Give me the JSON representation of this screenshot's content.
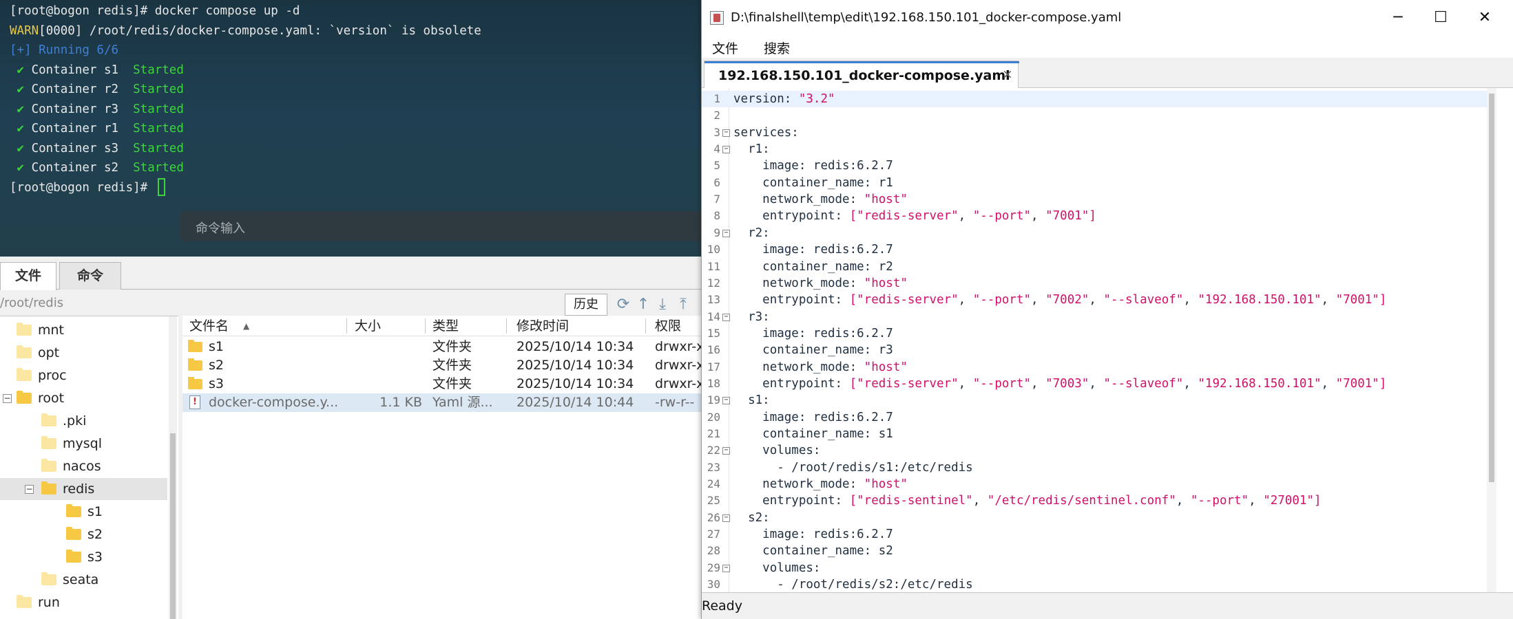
{
  "terminal": {
    "lines": [
      {
        "parts": [
          {
            "t": "[root@bogon redis]# docker compose up -d",
            "c": ""
          }
        ]
      },
      {
        "parts": [
          {
            "t": "WARN",
            "c": "c-warn"
          },
          {
            "t": "[0000] /root/redis/docker-compose.yaml: `version` is obsolete",
            "c": ""
          }
        ]
      },
      {
        "parts": [
          {
            "t": "[+] Running 6/6",
            "c": "c-blue"
          }
        ]
      },
      {
        "parts": [
          {
            "t": " ✔ ",
            "c": "c-check"
          },
          {
            "t": "Container s1  ",
            "c": ""
          },
          {
            "t": "Started",
            "c": "c-green"
          }
        ]
      },
      {
        "parts": [
          {
            "t": " ✔ ",
            "c": "c-check"
          },
          {
            "t": "Container r2  ",
            "c": ""
          },
          {
            "t": "Started",
            "c": "c-green"
          }
        ]
      },
      {
        "parts": [
          {
            "t": " ✔ ",
            "c": "c-check"
          },
          {
            "t": "Container r3  ",
            "c": ""
          },
          {
            "t": "Started",
            "c": "c-green"
          }
        ]
      },
      {
        "parts": [
          {
            "t": " ✔ ",
            "c": "c-check"
          },
          {
            "t": "Container r1  ",
            "c": ""
          },
          {
            "t": "Started",
            "c": "c-green"
          }
        ]
      },
      {
        "parts": [
          {
            "t": " ✔ ",
            "c": "c-check"
          },
          {
            "t": "Container s3  ",
            "c": ""
          },
          {
            "t": "Started",
            "c": "c-green"
          }
        ]
      },
      {
        "parts": [
          {
            "t": " ✔ ",
            "c": "c-check"
          },
          {
            "t": "Container s2  ",
            "c": ""
          },
          {
            "t": "Started",
            "c": "c-green"
          }
        ]
      },
      {
        "parts": [
          {
            "t": "[root@bogon redis]# ",
            "c": ""
          }
        ],
        "cursor": true
      }
    ],
    "command_placeholder": "命令输入"
  },
  "file_panel": {
    "tabs": [
      "文件",
      "命令"
    ],
    "path": "/root/redis",
    "history_label": "历史",
    "tree": [
      {
        "label": "mnt",
        "depth": 0,
        "expanded": false,
        "dim": true
      },
      {
        "label": "opt",
        "depth": 0,
        "expanded": false,
        "dim": true
      },
      {
        "label": "proc",
        "depth": 0,
        "expanded": false,
        "dim": true
      },
      {
        "label": "root",
        "depth": 0,
        "expanded": true,
        "dim": false
      },
      {
        "label": ".pki",
        "depth": 1,
        "expanded": false,
        "dim": true
      },
      {
        "label": "mysql",
        "depth": 1,
        "expanded": false,
        "dim": true
      },
      {
        "label": "nacos",
        "depth": 1,
        "expanded": false,
        "dim": true
      },
      {
        "label": "redis",
        "depth": 1,
        "expanded": true,
        "dim": false,
        "selected": true
      },
      {
        "label": "s1",
        "depth": 2,
        "expanded": false,
        "dim": false
      },
      {
        "label": "s2",
        "depth": 2,
        "expanded": false,
        "dim": false
      },
      {
        "label": "s3",
        "depth": 2,
        "expanded": false,
        "dim": false
      },
      {
        "label": "seata",
        "depth": 1,
        "expanded": false,
        "dim": true
      },
      {
        "label": "run",
        "depth": 0,
        "expanded": false,
        "dim": true
      }
    ],
    "columns": [
      "文件名",
      "大小",
      "类型",
      "修改时间",
      "权限"
    ],
    "files": [
      {
        "name": "s1",
        "size": "",
        "type": "文件夹",
        "mtime": "2025/10/14 10:34",
        "perm": "drwxr-x",
        "kind": "folder"
      },
      {
        "name": "s2",
        "size": "",
        "type": "文件夹",
        "mtime": "2025/10/14 10:34",
        "perm": "drwxr-x",
        "kind": "folder"
      },
      {
        "name": "s3",
        "size": "",
        "type": "文件夹",
        "mtime": "2025/10/14 10:34",
        "perm": "drwxr-x",
        "kind": "folder"
      },
      {
        "name": "docker-compose.y...",
        "size": "1.1 KB",
        "type": "Yaml 源...",
        "mtime": "2025/10/14 10:44",
        "perm": "-rw-r--",
        "kind": "file",
        "selected": true
      }
    ]
  },
  "editor": {
    "title": "D:\\finalshell\\temp\\edit\\192.168.150.101_docker-compose.yaml",
    "menus": [
      "文件",
      "搜索"
    ],
    "tab_label": "192.168.150.101_docker-compose.yaml",
    "tab_close": "×",
    "status": "Ready",
    "code": [
      {
        "n": "1",
        "parts": [
          [
            "k",
            "version"
          ],
          [
            "p",
            ": "
          ],
          [
            "s",
            "\"3.2\""
          ]
        ],
        "current": true
      },
      {
        "n": "2",
        "parts": []
      },
      {
        "n": "3",
        "parts": [
          [
            "k",
            "services"
          ],
          [
            "p",
            ":"
          ]
        ],
        "fold": true
      },
      {
        "n": "4",
        "parts": [
          [
            "p",
            "  "
          ],
          [
            "k",
            "r1"
          ],
          [
            "p",
            ":"
          ]
        ],
        "fold": true
      },
      {
        "n": "5",
        "parts": [
          [
            "p",
            "    "
          ],
          [
            "k",
            "image"
          ],
          [
            "p",
            ": redis:6.2.7"
          ]
        ]
      },
      {
        "n": "6",
        "parts": [
          [
            "p",
            "    "
          ],
          [
            "k",
            "container_name"
          ],
          [
            "p",
            ": r1"
          ]
        ]
      },
      {
        "n": "7",
        "parts": [
          [
            "p",
            "    "
          ],
          [
            "k",
            "network_mode"
          ],
          [
            "p",
            ": "
          ],
          [
            "s",
            "\"host\""
          ]
        ]
      },
      {
        "n": "8",
        "parts": [
          [
            "p",
            "    "
          ],
          [
            "k",
            "entrypoint"
          ],
          [
            "p",
            ": "
          ],
          [
            "s",
            "["
          ],
          [
            "s",
            "\"redis-server\""
          ],
          [
            "p",
            ", "
          ],
          [
            "s",
            "\"--port\""
          ],
          [
            "p",
            ", "
          ],
          [
            "s",
            "\"7001\""
          ],
          [
            "s",
            "]"
          ]
        ]
      },
      {
        "n": "9",
        "parts": [
          [
            "p",
            "  "
          ],
          [
            "k",
            "r2"
          ],
          [
            "p",
            ":"
          ]
        ],
        "fold": true
      },
      {
        "n": "10",
        "parts": [
          [
            "p",
            "    "
          ],
          [
            "k",
            "image"
          ],
          [
            "p",
            ": redis:6.2.7"
          ]
        ]
      },
      {
        "n": "11",
        "parts": [
          [
            "p",
            "    "
          ],
          [
            "k",
            "container_name"
          ],
          [
            "p",
            ": r2"
          ]
        ]
      },
      {
        "n": "12",
        "parts": [
          [
            "p",
            "    "
          ],
          [
            "k",
            "network_mode"
          ],
          [
            "p",
            ": "
          ],
          [
            "s",
            "\"host\""
          ]
        ]
      },
      {
        "n": "13",
        "parts": [
          [
            "p",
            "    "
          ],
          [
            "k",
            "entrypoint"
          ],
          [
            "p",
            ": "
          ],
          [
            "s",
            "["
          ],
          [
            "s",
            "\"redis-server\""
          ],
          [
            "p",
            ", "
          ],
          [
            "s",
            "\"--port\""
          ],
          [
            "p",
            ", "
          ],
          [
            "s",
            "\"7002\""
          ],
          [
            "p",
            ", "
          ],
          [
            "s",
            "\"--slaveof\""
          ],
          [
            "p",
            ", "
          ],
          [
            "s",
            "\"192.168.150.101\""
          ],
          [
            "p",
            ", "
          ],
          [
            "s",
            "\"7001\""
          ],
          [
            "s",
            "]"
          ]
        ]
      },
      {
        "n": "14",
        "parts": [
          [
            "p",
            "  "
          ],
          [
            "k",
            "r3"
          ],
          [
            "p",
            ":"
          ]
        ],
        "fold": true
      },
      {
        "n": "15",
        "parts": [
          [
            "p",
            "    "
          ],
          [
            "k",
            "image"
          ],
          [
            "p",
            ": redis:6.2.7"
          ]
        ]
      },
      {
        "n": "16",
        "parts": [
          [
            "p",
            "    "
          ],
          [
            "k",
            "container_name"
          ],
          [
            "p",
            ": r3"
          ]
        ]
      },
      {
        "n": "17",
        "parts": [
          [
            "p",
            "    "
          ],
          [
            "k",
            "network_mode"
          ],
          [
            "p",
            ": "
          ],
          [
            "s",
            "\"host\""
          ]
        ]
      },
      {
        "n": "18",
        "parts": [
          [
            "p",
            "    "
          ],
          [
            "k",
            "entrypoint"
          ],
          [
            "p",
            ": "
          ],
          [
            "s",
            "["
          ],
          [
            "s",
            "\"redis-server\""
          ],
          [
            "p",
            ", "
          ],
          [
            "s",
            "\"--port\""
          ],
          [
            "p",
            ", "
          ],
          [
            "s",
            "\"7003\""
          ],
          [
            "p",
            ", "
          ],
          [
            "s",
            "\"--slaveof\""
          ],
          [
            "p",
            ", "
          ],
          [
            "s",
            "\"192.168.150.101\""
          ],
          [
            "p",
            ", "
          ],
          [
            "s",
            "\"7001\""
          ],
          [
            "s",
            "]"
          ]
        ]
      },
      {
        "n": "19",
        "parts": [
          [
            "p",
            "  "
          ],
          [
            "k",
            "s1"
          ],
          [
            "p",
            ":"
          ]
        ],
        "fold": true
      },
      {
        "n": "20",
        "parts": [
          [
            "p",
            "    "
          ],
          [
            "k",
            "image"
          ],
          [
            "p",
            ": redis:6.2.7"
          ]
        ]
      },
      {
        "n": "21",
        "parts": [
          [
            "p",
            "    "
          ],
          [
            "k",
            "container_name"
          ],
          [
            "p",
            ": s1"
          ]
        ]
      },
      {
        "n": "22",
        "parts": [
          [
            "p",
            "    "
          ],
          [
            "k",
            "volumes"
          ],
          [
            "p",
            ":"
          ]
        ],
        "fold": true
      },
      {
        "n": "23",
        "parts": [
          [
            "p",
            "      - /root/redis/s1:/etc/redis"
          ]
        ]
      },
      {
        "n": "24",
        "parts": [
          [
            "p",
            "    "
          ],
          [
            "k",
            "network_mode"
          ],
          [
            "p",
            ": "
          ],
          [
            "s",
            "\"host\""
          ]
        ]
      },
      {
        "n": "25",
        "parts": [
          [
            "p",
            "    "
          ],
          [
            "k",
            "entrypoint"
          ],
          [
            "p",
            ": "
          ],
          [
            "s",
            "["
          ],
          [
            "s",
            "\"redis-sentinel\""
          ],
          [
            "p",
            ", "
          ],
          [
            "s",
            "\"/etc/redis/sentinel.conf\""
          ],
          [
            "p",
            ", "
          ],
          [
            "s",
            "\"--port\""
          ],
          [
            "p",
            ", "
          ],
          [
            "s",
            "\"27001\""
          ],
          [
            "s",
            "]"
          ]
        ]
      },
      {
        "n": "26",
        "parts": [
          [
            "p",
            "  "
          ],
          [
            "k",
            "s2"
          ],
          [
            "p",
            ":"
          ]
        ],
        "fold": true
      },
      {
        "n": "27",
        "parts": [
          [
            "p",
            "    "
          ],
          [
            "k",
            "image"
          ],
          [
            "p",
            ": redis:6.2.7"
          ]
        ]
      },
      {
        "n": "28",
        "parts": [
          [
            "p",
            "    "
          ],
          [
            "k",
            "container_name"
          ],
          [
            "p",
            ": s2"
          ]
        ]
      },
      {
        "n": "29",
        "parts": [
          [
            "p",
            "    "
          ],
          [
            "k",
            "volumes"
          ],
          [
            "p",
            ":"
          ]
        ],
        "fold": true
      },
      {
        "n": "30",
        "parts": [
          [
            "p",
            "      - /root/redis/s2:/etc/redis"
          ]
        ]
      }
    ]
  }
}
